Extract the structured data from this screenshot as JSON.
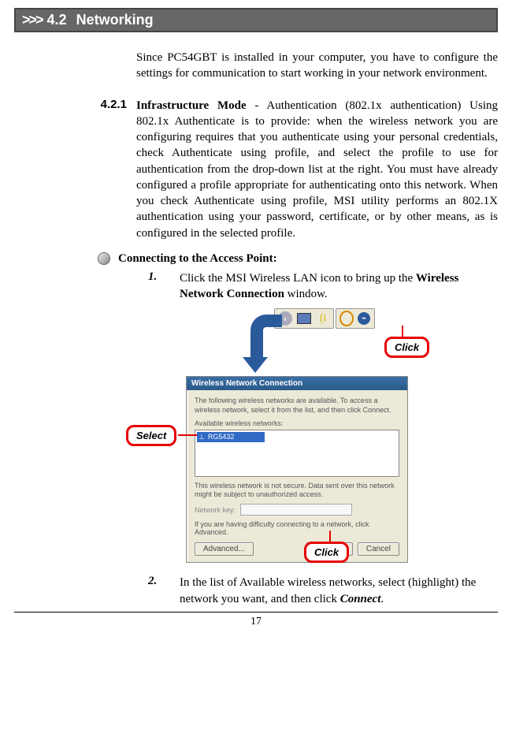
{
  "header": {
    "chevron": ">>>",
    "num": "4.2",
    "title": "Networking"
  },
  "intro": "Since PC54GBT is installed in your computer, you have to configure the settings for communication to start working in your network environment.",
  "sec421": {
    "num": "4.2.1",
    "lead": "Infrastructure Mode",
    "rest": " - Authentication (802.1x authentication) Using 802.1x Authenticate is to provide: when the wireless network you are configuring requires that you authenticate using your personal credentials, check Authenticate using profile, and select the profile to use for authentication from the drop-down list at the right.  You must have already configured a profile appropriate for authenticating onto this network.  When you check Authenticate using profile, MSI utility performs an 802.1X authentication using your password, certificate, or by other means, as is configured in the selected profile."
  },
  "subhead": "Connecting to the Access Point:",
  "step1": {
    "num": "1.",
    "p1": "Click the MSI Wireless LAN icon to bring up the ",
    "bold": "Wireless Network Connection",
    "p2": " window."
  },
  "dialog": {
    "title": "Wireless Network Connection",
    "intro": "The following wireless networks are available. To access a wireless network, select it from the list, and then click Connect.",
    "avail": "Available wireless networks:",
    "ssid": "RG5432",
    "warn": "This wireless network is not secure. Data sent over this network might be subject to unauthorized access.",
    "netkey": "Network key:",
    "having": "If you are having difficulty connecting to a network, click Advanced.",
    "adv": "Advanced...",
    "connect": "Connect",
    "cancel": "Cancel"
  },
  "callouts": {
    "click": "Click",
    "select": "Select"
  },
  "step2": {
    "num": "2.",
    "p1": "In the list of Available wireless networks, select (highlight) the network you want, and then click ",
    "bold": "Connect",
    "p2": "."
  },
  "pageNum": "17"
}
